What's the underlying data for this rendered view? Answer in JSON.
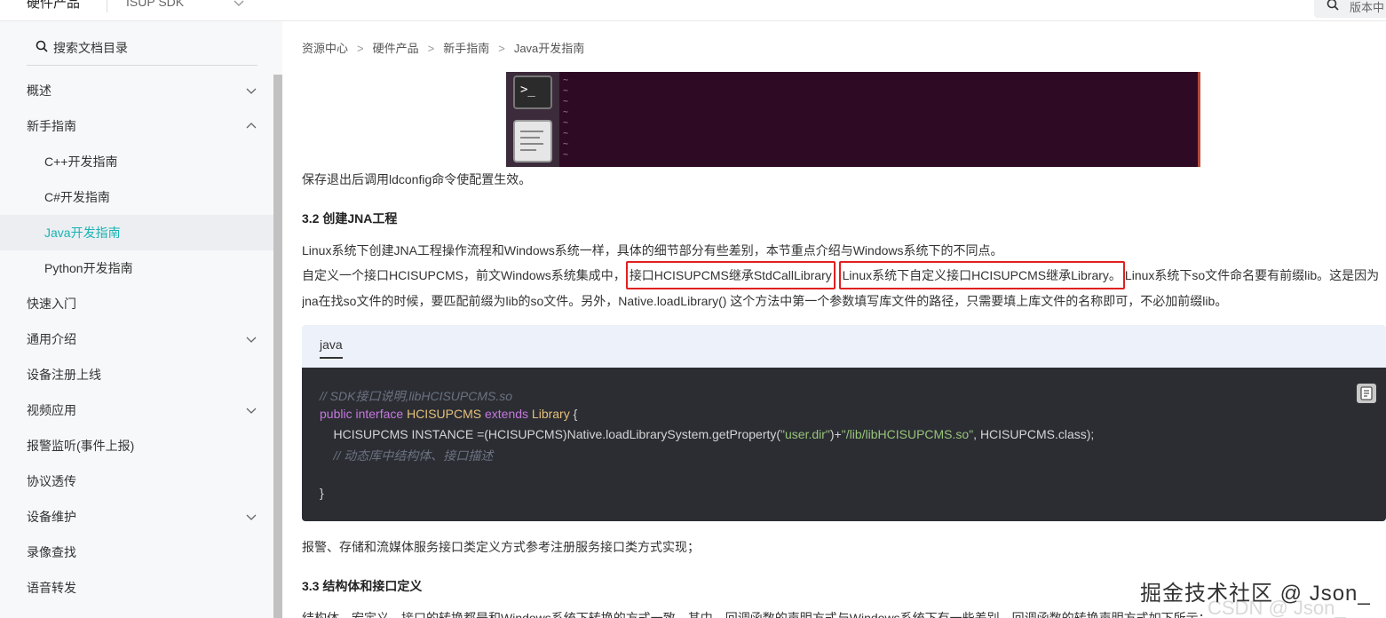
{
  "topbar": {
    "brand": "硬件产品",
    "product": "ISUP SDK",
    "search_label": "版本中"
  },
  "sidebar": {
    "search_label": "搜索文档目录",
    "items": [
      {
        "label": "概述",
        "expandable": true,
        "expanded": false
      },
      {
        "label": "新手指南",
        "expandable": true,
        "expanded": true
      },
      {
        "label": "C++开发指南",
        "sub": true
      },
      {
        "label": "C#开发指南",
        "sub": true
      },
      {
        "label": "Java开发指南",
        "sub": true,
        "active": true
      },
      {
        "label": "Python开发指南",
        "sub": true
      },
      {
        "label": "快速入门"
      },
      {
        "label": "通用介绍",
        "expandable": true,
        "expanded": false
      },
      {
        "label": "设备注册上线"
      },
      {
        "label": "视频应用",
        "expandable": true,
        "expanded": false
      },
      {
        "label": "报警监听(事件上报)"
      },
      {
        "label": "协议透传"
      },
      {
        "label": "设备维护",
        "expandable": true,
        "expanded": false
      },
      {
        "label": "录像查找"
      },
      {
        "label": "语音转发"
      }
    ]
  },
  "breadcrumb": [
    "资源中心",
    "硬件产品",
    "新手指南",
    "Java开发指南"
  ],
  "terminal": {
    "prompt_glyph": ">_",
    "tilde": "~"
  },
  "content": {
    "p_ldconfig": "保存退出后调用ldconfig命令使配置生效。",
    "h_3_2": "3.2 创建JNA工程",
    "p_linux_intro": "Linux系统下创建JNA工程操作流程和Windows系统一样，具体的细节部分有些差别，本节重点介绍与Windows系统下的不同点。",
    "p_define_a": "自定义一个接口HCISUPCMS，前文Windows系统集成中，",
    "p_define_box1": "接口HCISUPCMS继承StdCallLibrary",
    "p_define_box2": "Linux系统下自定义接口HCISUPCMS继承Library。",
    "p_define_c": "Linux系统下so文件命名要有前缀lib。这是因为",
    "p_jna_line": "jna在找so文件的时候，要匹配前缀为lib的so文件。另外，Native.loadLibrary() 这个方法中第一个参数填写库文件的路径，只需要填上库文件的名称即可，不必加前缀lib。",
    "code": {
      "tab": "java",
      "comment1": "// SDK接口说明,libHCISUPCMS.so",
      "kw_public": "public",
      "kw_interface": "interface",
      "type_name": "HCISUPCMS",
      "kw_extends": "extends",
      "type_library": "Library",
      "brace_open": " {",
      "l3_a": "    HCISUPCMS INSTANCE =(HCISUPCMS)Native.loadLibrarySystem.getProperty(",
      "l3_s1": "\"user.dir\"",
      "l3_b": ")+",
      "l3_s2": "\"/lib/libHCISUPCMS.so\"",
      "l3_c": ", HCISUPCMS.class);",
      "comment2": "    // 动态库中结构体、接口描述",
      "brace_close": "}"
    },
    "p_alarm": "报警、存储和流媒体服务接口类定义方式参考注册服务接口类方式实现；",
    "h_3_3": "3.3 结构体和接口定义",
    "p_struct": "结构体、宏定义、接口的转换都是和Windows系统下转换的方式一致，其中，回调函数的声明方式与Windows系统下有一些差别，回调函数的转换声明方式如下所示："
  },
  "watermark": {
    "main": "掘金技术社区 @ Json_",
    "sub": "CSDN @ Json_"
  },
  "colors": {
    "accent": "#19b4b4",
    "highlight_box": "#e02020",
    "code_bg": "#2b2d33"
  }
}
